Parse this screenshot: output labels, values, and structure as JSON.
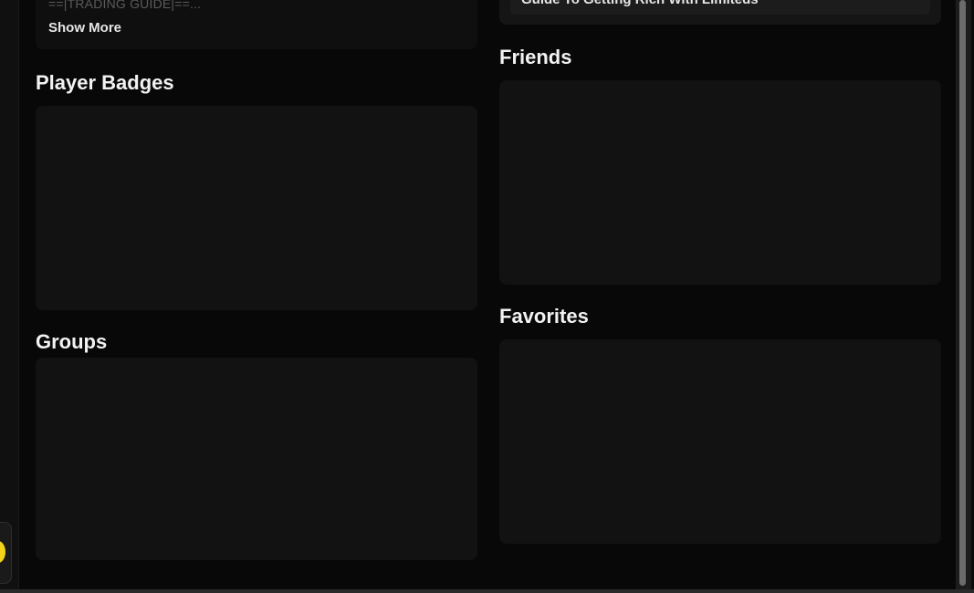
{
  "about": {
    "text_snippet": "==|TRADING GUIDE|==...",
    "show_more_label": "Show More"
  },
  "top_right": {
    "item_text": "Guide To Getting Rich With Limiteds"
  },
  "sections": {
    "player_badges": "Player Badges",
    "groups": "Groups",
    "friends": "Friends",
    "favorites": "Favorites"
  },
  "colors": {
    "background": "#080808",
    "panel": "#121212",
    "title_text": "#f2f2f2",
    "muted_text": "#5a5a5a",
    "widget_accent": "#f2d21b"
  },
  "icons": {
    "side_widget": "yellow-avatar-icon"
  }
}
